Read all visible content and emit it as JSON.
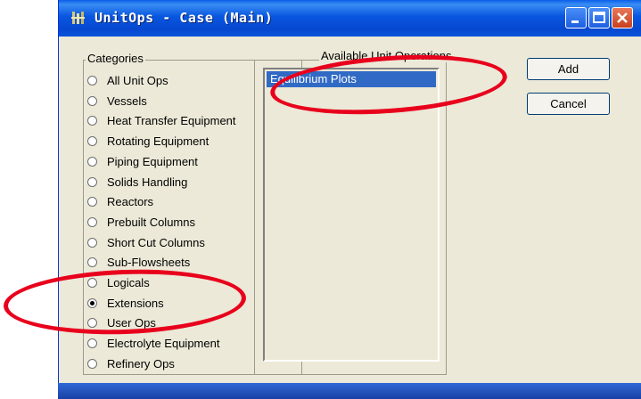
{
  "window": {
    "title": "UnitOps - Case (Main)"
  },
  "categories": {
    "label": "Categories",
    "items": [
      {
        "label": "All Unit Ops",
        "checked": false
      },
      {
        "label": "Vessels",
        "checked": false
      },
      {
        "label": "Heat Transfer Equipment",
        "checked": false
      },
      {
        "label": "Rotating Equipment",
        "checked": false
      },
      {
        "label": "Piping Equipment",
        "checked": false
      },
      {
        "label": "Solids Handling",
        "checked": false
      },
      {
        "label": "Reactors",
        "checked": false
      },
      {
        "label": "Prebuilt Columns",
        "checked": false
      },
      {
        "label": "Short Cut Columns",
        "checked": false
      },
      {
        "label": "Sub-Flowsheets",
        "checked": false
      },
      {
        "label": "Logicals",
        "checked": false
      },
      {
        "label": "Extensions",
        "checked": true
      },
      {
        "label": "User Ops",
        "checked": false
      },
      {
        "label": "Electrolyte Equipment",
        "checked": false
      },
      {
        "label": "Refinery Ops",
        "checked": false
      }
    ]
  },
  "available": {
    "label": "Available Unit Operations",
    "items": [
      "Equilibrium Plots"
    ]
  },
  "buttons": {
    "add": "Add",
    "cancel": "Cancel"
  },
  "colors": {
    "annotation": "#e8001c",
    "selection": "#316ac5",
    "titlebar": "#0856e0"
  }
}
